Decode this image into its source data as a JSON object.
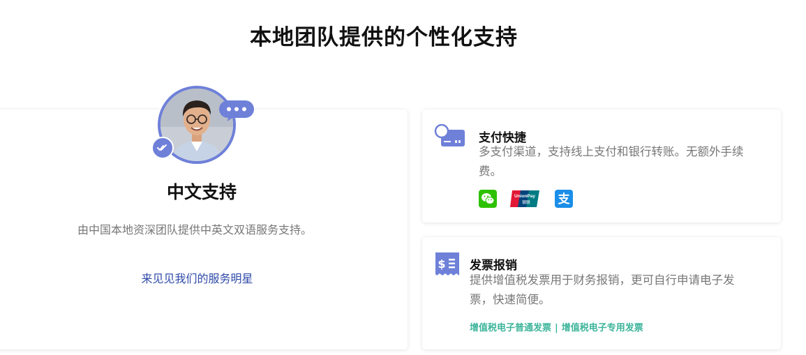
{
  "section": {
    "title": "本地团队提供的个性化支持"
  },
  "support_card": {
    "heading": "中文支持",
    "description": "由中国本地资深团队提供中英文双语服务支持。",
    "link": "来见见我们的服务明星"
  },
  "payment_card": {
    "title": "支付快捷",
    "description": "多支付渠道，支持线上支付和银行转账。无额外手续费。",
    "payment_methods": [
      {
        "name": "WeChat Pay",
        "icon": "wechat-pay-icon",
        "color": "#2dc100"
      },
      {
        "name": "UnionPay",
        "icon": "unionpay-icon",
        "color": "#e21836"
      },
      {
        "name": "Alipay",
        "icon": "alipay-icon",
        "color": "#1a8ee8"
      }
    ],
    "unionpay_text": {
      "top": "UnionPay",
      "bottom": "银联"
    }
  },
  "invoice_card": {
    "title": "发票报销",
    "description": "提供增值税发票用于财务报销，更可自行申请电子发票，快速简便。",
    "links": [
      "增值税电子普通发票",
      "增值税电子专用发票"
    ],
    "separator": "|"
  },
  "colors": {
    "accent": "#6e80d8",
    "link": "#2f4aa8",
    "invoice_link": "#3db59b",
    "muted_text": "#777777"
  }
}
